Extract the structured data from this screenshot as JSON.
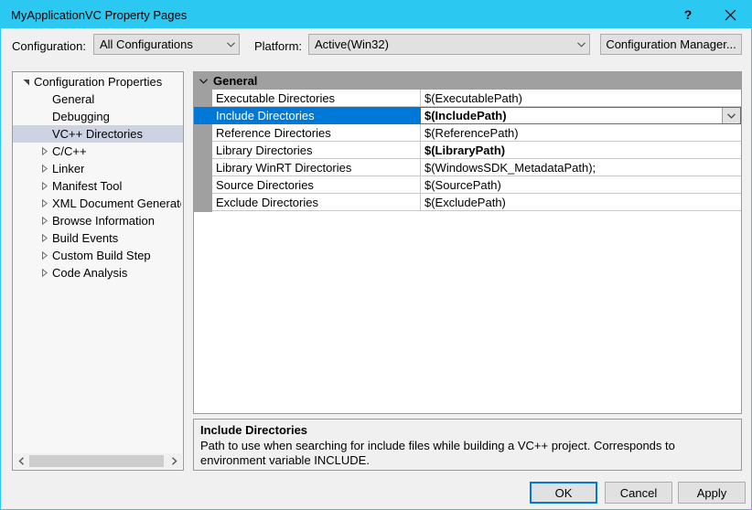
{
  "window": {
    "title": "MyApplicationVC Property Pages",
    "help_label": "?",
    "close_label": "✕"
  },
  "toolbar": {
    "configuration_label": "Configuration:",
    "configuration_value": "All Configurations",
    "platform_label": "Platform:",
    "platform_value": "Active(Win32)",
    "configuration_manager_label": "Configuration Manager..."
  },
  "tree": {
    "items": [
      {
        "label": "Configuration Properties",
        "indent": 0,
        "expander": "expanded",
        "selected": false
      },
      {
        "label": "General",
        "indent": 1,
        "expander": "none",
        "selected": false
      },
      {
        "label": "Debugging",
        "indent": 1,
        "expander": "none",
        "selected": false
      },
      {
        "label": "VC++ Directories",
        "indent": 1,
        "expander": "none",
        "selected": true
      },
      {
        "label": "C/C++",
        "indent": 1,
        "expander": "collapsed",
        "selected": false
      },
      {
        "label": "Linker",
        "indent": 1,
        "expander": "collapsed",
        "selected": false
      },
      {
        "label": "Manifest Tool",
        "indent": 1,
        "expander": "collapsed",
        "selected": false
      },
      {
        "label": "XML Document Generator",
        "indent": 1,
        "expander": "collapsed",
        "selected": false
      },
      {
        "label": "Browse Information",
        "indent": 1,
        "expander": "collapsed",
        "selected": false
      },
      {
        "label": "Build Events",
        "indent": 1,
        "expander": "collapsed",
        "selected": false
      },
      {
        "label": "Custom Build Step",
        "indent": 1,
        "expander": "collapsed",
        "selected": false
      },
      {
        "label": "Code Analysis",
        "indent": 1,
        "expander": "collapsed",
        "selected": false
      }
    ]
  },
  "grid": {
    "group_label": "General",
    "rows": [
      {
        "name": "Executable Directories",
        "value": "$(ExecutablePath)",
        "bold": false,
        "selected": false
      },
      {
        "name": "Include Directories",
        "value": "$(IncludePath)",
        "bold": true,
        "selected": true
      },
      {
        "name": "Reference Directories",
        "value": "$(ReferencePath)",
        "bold": false,
        "selected": false
      },
      {
        "name": "Library Directories",
        "value": "$(LibraryPath)",
        "bold": true,
        "selected": false
      },
      {
        "name": "Library WinRT Directories",
        "value": "$(WindowsSDK_MetadataPath);",
        "bold": false,
        "selected": false
      },
      {
        "name": "Source Directories",
        "value": "$(SourcePath)",
        "bold": false,
        "selected": false
      },
      {
        "name": "Exclude Directories",
        "value": "$(ExcludePath)",
        "bold": false,
        "selected": false
      }
    ]
  },
  "description": {
    "title": "Include Directories",
    "body": "Path to use when searching for include files while building a VC++ project.  Corresponds to environment variable INCLUDE."
  },
  "footer": {
    "ok_label": "OK",
    "cancel_label": "Cancel",
    "apply_label": "Apply"
  },
  "colors": {
    "titlebar": "#2bc9f2",
    "selection_blue": "#0078d7",
    "tree_selection": "#cdd3e3",
    "group_header_gray": "#a0a0a0",
    "dialog_background": "#f0f0f0"
  }
}
